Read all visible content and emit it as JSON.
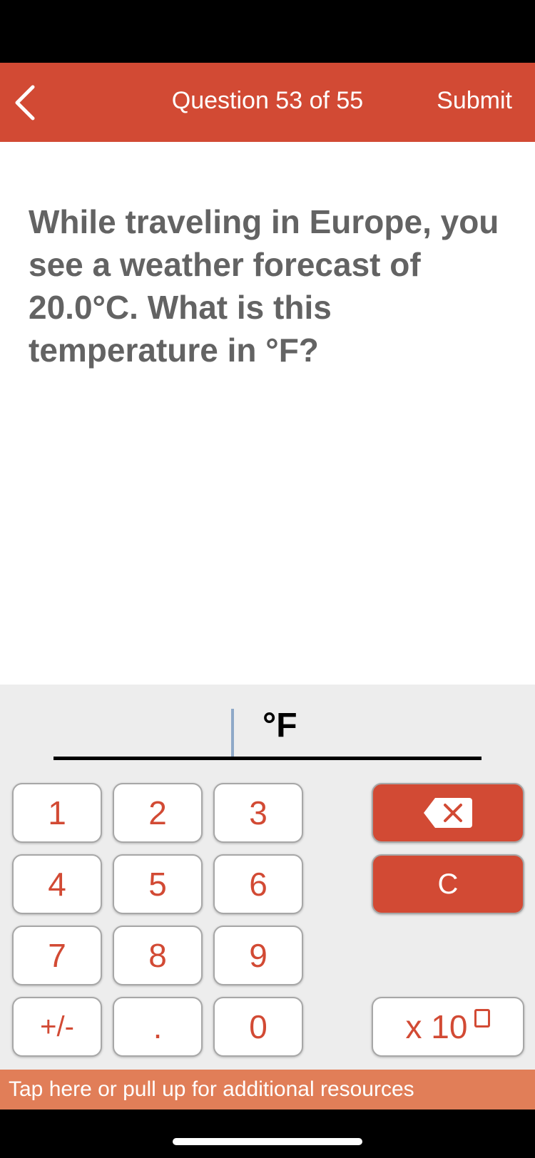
{
  "header": {
    "back_icon": "chevron-left-icon",
    "title": "Question 53 of 55",
    "submit_label": "Submit"
  },
  "question": {
    "text": "While traveling in Europe, you see a weather forecast of 20.0°C. What is this temperature in °F?"
  },
  "answer": {
    "value": "",
    "unit": "°F"
  },
  "keypad": {
    "keys": [
      "1",
      "2",
      "3",
      "4",
      "5",
      "6",
      "7",
      "8",
      "9",
      "+/-",
      ".",
      "0"
    ],
    "backspace_icon": "backspace-icon",
    "clear_label": "C",
    "exponent_label": "x 10"
  },
  "footer": {
    "resources_label": "Tap here or pull up for additional resources"
  },
  "colors": {
    "accent": "#d24a34",
    "resources_bar": "#e17e58",
    "question_text": "#636363",
    "keypad_bg": "#ededed"
  }
}
